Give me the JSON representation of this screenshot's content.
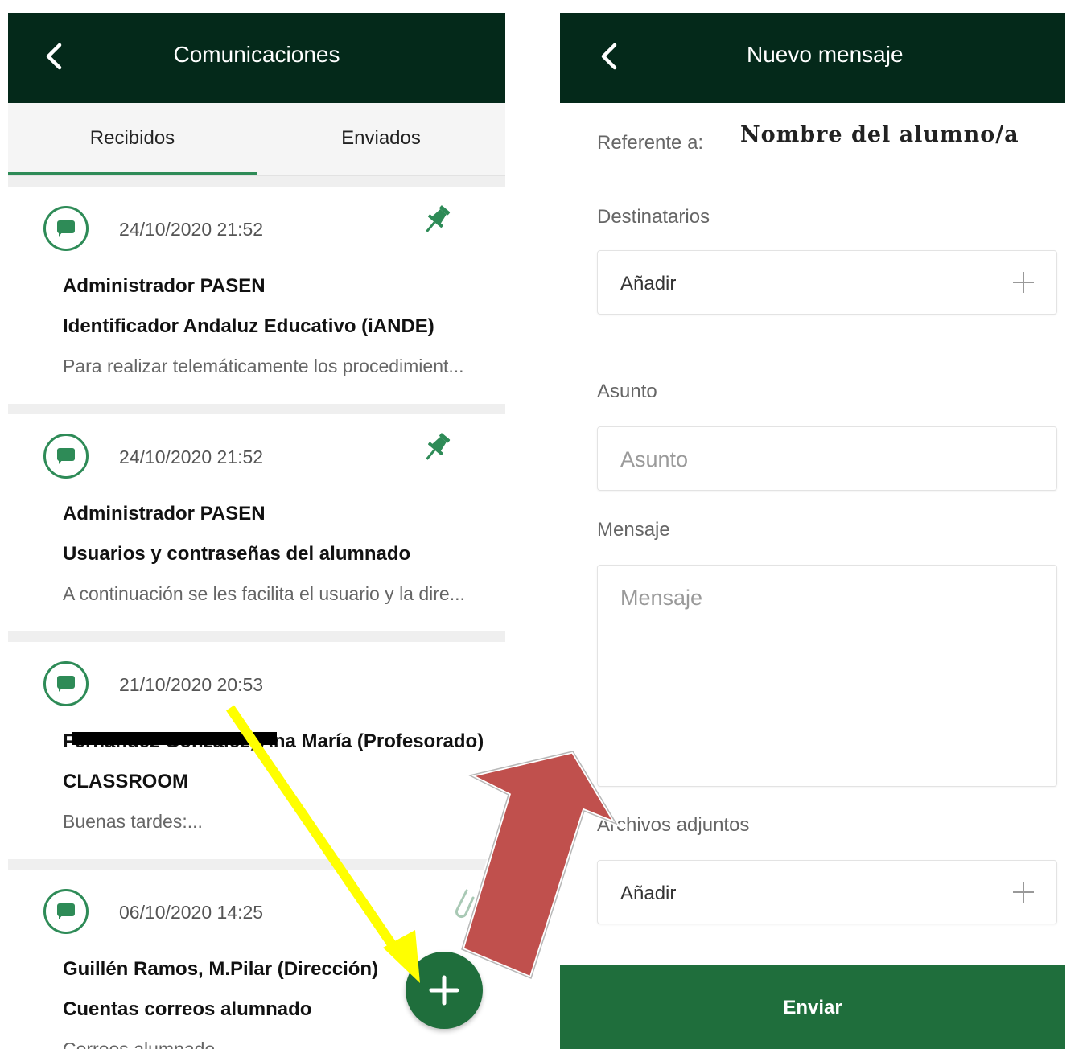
{
  "left_screen": {
    "title": "Comunicaciones",
    "tabs": [
      {
        "label": "Recibidos",
        "active": true
      },
      {
        "label": "Enviados",
        "active": false
      }
    ],
    "messages": [
      {
        "date": "24/10/2020 21:52",
        "sender": "Administrador PASEN",
        "subject": "Identificador Andaluz Educativo (iANDE)",
        "preview": "Para realizar telemáticamente los procedimient...",
        "pinned": true,
        "attachment": false
      },
      {
        "date": "24/10/2020 21:52",
        "sender": "Administrador PASEN",
        "subject": "Usuarios y contraseñas del alumnado",
        "preview": "A continuación se les facilita el usuario y la dire...",
        "pinned": true,
        "attachment": false
      },
      {
        "date": "21/10/2020 20:53",
        "sender": "Fernández González, Ana María (Profesorado)",
        "subject": "CLASSROOM",
        "preview": "Buenas tardes:...",
        "pinned": false,
        "attachment": false
      },
      {
        "date": "06/10/2020 14:25",
        "sender": "Guillén Ramos, M.Pilar (Dirección)",
        "subject": "Cuentas correos alumnado",
        "preview": "Correos alumnado",
        "pinned": false,
        "attachment": true
      }
    ]
  },
  "right_screen": {
    "title": "Nuevo mensaje",
    "reference_label": "Referente a:",
    "student_name": "Nombre del alumno/a",
    "recipients_label": "Destinatarios",
    "recipients_button": "Añadir",
    "subject_label": "Asunto",
    "subject_placeholder": "Asunto",
    "message_label": "Mensaje",
    "message_placeholder": "Mensaje",
    "attachments_label": "Archivos adjuntos",
    "attachments_button": "Añadir",
    "send_button": "Enviar"
  },
  "colors": {
    "header_bg": "#04291a",
    "accent_green": "#2e8b57",
    "button_green": "#1f6e3c",
    "annotation_yellow": "#ffff00",
    "annotation_red": "#c0504d"
  }
}
